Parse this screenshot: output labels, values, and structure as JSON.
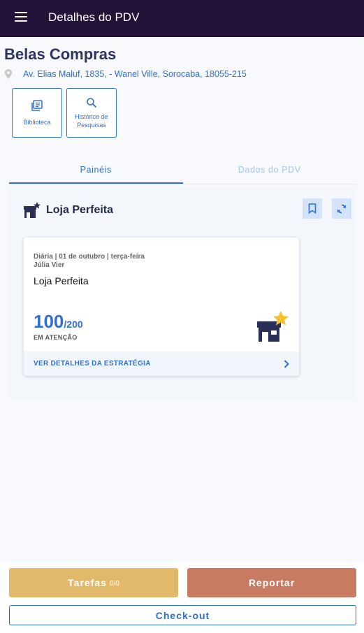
{
  "header": {
    "title": "Detalhes do PDV",
    "menu_icon": "hamburger-menu-icon"
  },
  "store": {
    "name": "Belas Compras",
    "address": "Av. Elias Maluf, 1835,  - Wanel Ville, Sorocaba, 18055-215"
  },
  "actions": [
    {
      "label": "Biblioteca",
      "icon": "library-icon"
    },
    {
      "label": "Histórico de Pesquisas",
      "icon": "search-icon"
    }
  ],
  "tabs": [
    {
      "label": "Painéis",
      "active": true
    },
    {
      "label": "Dados do PDV",
      "active": false
    }
  ],
  "panel": {
    "title": "Loja Perfeita",
    "title_icon": "store-star-icon"
  },
  "card": {
    "meta_line1": "Diária |  01 de outubro | terça-feira",
    "meta_line2": "Júlia Vier",
    "name": "Loja Perfeita",
    "score": "100",
    "score_total": "/200",
    "score_value": 100,
    "score_max": 200,
    "status": "EM ATENÇÃO",
    "footer_label": "VER DETALHES DA ESTRATÉGIA"
  },
  "bottom": {
    "tasks_label": "Tarefas",
    "tasks_count": "0/0",
    "report_label": "Reportar",
    "checkout_label": "Check-out"
  },
  "colors": {
    "header_bg": "#231339",
    "accent_blue": "#2f6fd1",
    "tasks_bg": "#e2b96a",
    "report_bg": "#c97b62",
    "star": "#f2c12e"
  }
}
